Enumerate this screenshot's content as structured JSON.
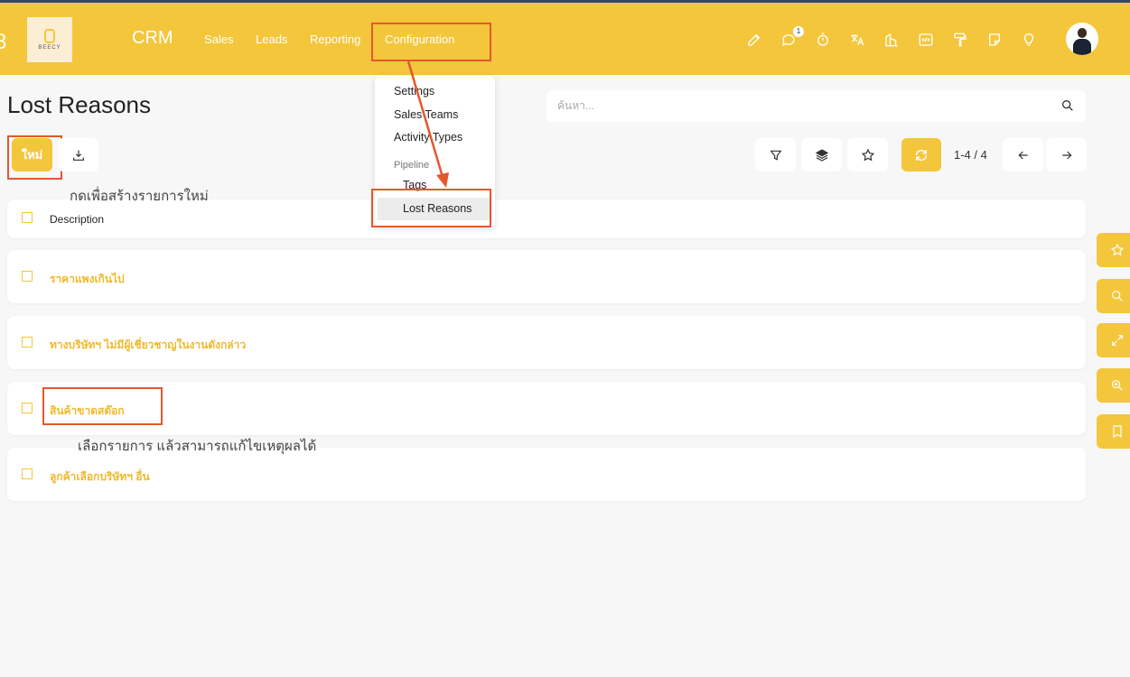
{
  "navbar": {
    "app_name": "CRM",
    "logo_text": "BEECY",
    "menu": {
      "sales": "Sales",
      "leads": "Leads",
      "reporting": "Reporting",
      "configuration": "Configuration"
    },
    "chat_badge": "1",
    "icons": [
      "edit-icon",
      "chat-icon",
      "timer-icon",
      "translate-icon",
      "building-icon",
      "code-icon",
      "paint-roller-icon",
      "note-icon",
      "lightbulb-icon"
    ]
  },
  "page": {
    "title": "Lost Reasons",
    "search_placeholder": "ค้นหา..."
  },
  "toolbar": {
    "new_label": "ใหม่",
    "pager": "1-4 / 4"
  },
  "dropdown": {
    "settings": "Settings",
    "sales_teams": "Sales Teams",
    "activity_types": "Activity Types",
    "pipeline_header": "Pipeline",
    "tags": "Tags",
    "lost_reasons": "Lost Reasons"
  },
  "notes": {
    "create": "กดเพื่อสร้างรายการใหม่",
    "edit": "เลือกรายการ แล้วสามารถแก้ไขเหตุผลได้"
  },
  "list": {
    "header": "Description",
    "rows": [
      "ราคาแพงเกินไป",
      "ทางบริษัทฯ ไม่มีผู้เชี่ยวชาญในงานดังกล่าว",
      "สินค้าขาดสต๊อก",
      "ลูกค้าเลือกบริษัทฯ อื่น"
    ]
  },
  "colors": {
    "brand": "#f4c63b",
    "annotation": "#e4572e",
    "row_text": "#f0b92c"
  }
}
